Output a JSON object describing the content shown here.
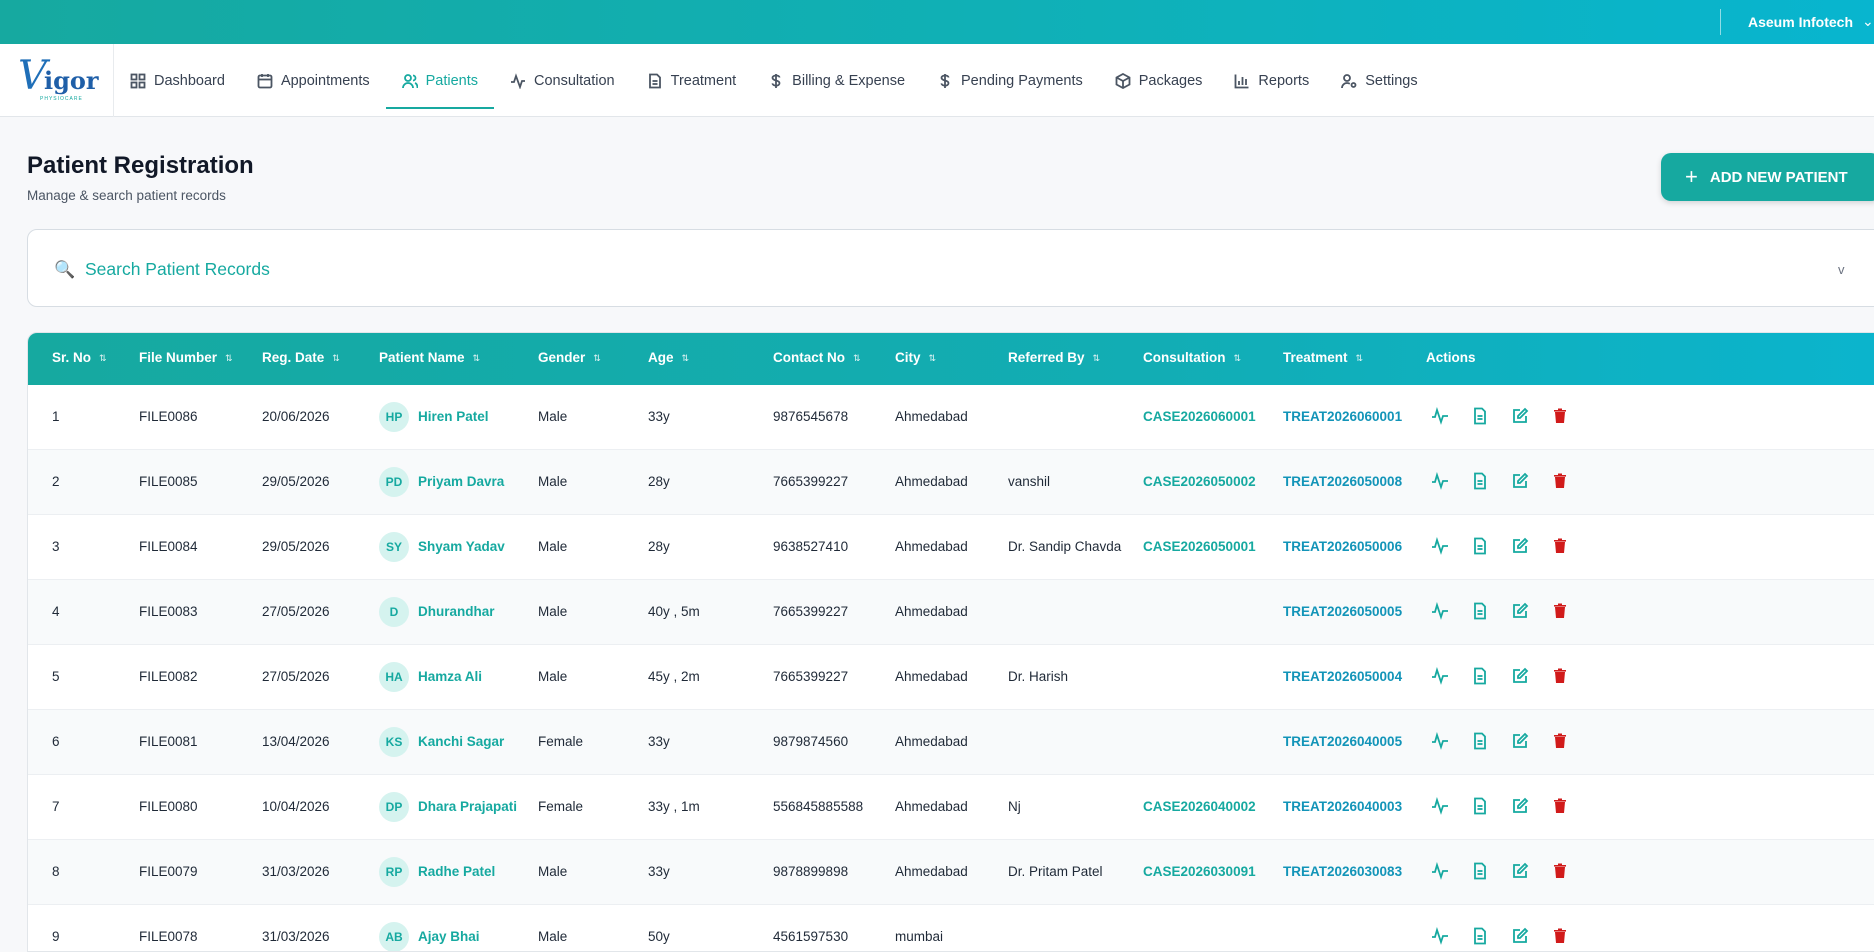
{
  "header": {
    "org": "Aseum Infotech"
  },
  "logo": {
    "letter": "V",
    "text": "igor",
    "tagline": "PHYSIOCARE"
  },
  "nav": [
    {
      "label": "Dashboard",
      "icon": "dashboard-icon"
    },
    {
      "label": "Appointments",
      "icon": "calendar-icon"
    },
    {
      "label": "Patients",
      "icon": "users-icon",
      "active": true
    },
    {
      "label": "Consultation",
      "icon": "activity-icon"
    },
    {
      "label": "Treatment",
      "icon": "document-icon"
    },
    {
      "label": "Billing & Expense",
      "icon": "dollar-icon"
    },
    {
      "label": "Pending Payments",
      "icon": "dollar-icon"
    },
    {
      "label": "Packages",
      "icon": "package-icon"
    },
    {
      "label": "Reports",
      "icon": "bar-chart-icon"
    },
    {
      "label": "Settings",
      "icon": "user-settings-icon"
    }
  ],
  "page": {
    "title": "Patient Registration",
    "subtitle": "Manage & search patient records",
    "add_button": "ADD NEW PATIENT"
  },
  "search": {
    "title": "Search Patient Records",
    "toggle": "v"
  },
  "table": {
    "columns": [
      "Sr. No",
      "File Number",
      "Reg. Date",
      "Patient Name",
      "Gender",
      "Age",
      "Contact No",
      "City",
      "Referred By",
      "Consultation",
      "Treatment",
      "Actions"
    ],
    "rows": [
      {
        "sr": "1",
        "file": "FILE0086",
        "date": "20/06/2026",
        "initials": "HP",
        "name": "Hiren Patel",
        "gender": "Male",
        "age": "33y",
        "contact": "9876545678",
        "city": "Ahmedabad",
        "ref": "",
        "consult": "CASE2026060001",
        "treat": "TREAT2026060001"
      },
      {
        "sr": "2",
        "file": "FILE0085",
        "date": "29/05/2026",
        "initials": "PD",
        "name": "Priyam Davra",
        "gender": "Male",
        "age": "28y",
        "contact": "7665399227",
        "city": "Ahmedabad",
        "ref": "vanshil",
        "consult": "CASE2026050002",
        "treat": "TREAT2026050008"
      },
      {
        "sr": "3",
        "file": "FILE0084",
        "date": "29/05/2026",
        "initials": "SY",
        "name": "Shyam Yadav",
        "gender": "Male",
        "age": "28y",
        "contact": "9638527410",
        "city": "Ahmedabad",
        "ref": "Dr. Sandip Chavda",
        "consult": "CASE2026050001",
        "treat": "TREAT2026050006"
      },
      {
        "sr": "4",
        "file": "FILE0083",
        "date": "27/05/2026",
        "initials": "D",
        "name": "Dhurandhar",
        "gender": "Male",
        "age": "40y , 5m",
        "contact": "7665399227",
        "city": "Ahmedabad",
        "ref": "",
        "consult": "",
        "treat": "TREAT2026050005"
      },
      {
        "sr": "5",
        "file": "FILE0082",
        "date": "27/05/2026",
        "initials": "HA",
        "name": "Hamza Ali",
        "gender": "Male",
        "age": "45y , 2m",
        "contact": "7665399227",
        "city": "Ahmedabad",
        "ref": "Dr. Harish",
        "consult": "",
        "treat": "TREAT2026050004"
      },
      {
        "sr": "6",
        "file": "FILE0081",
        "date": "13/04/2026",
        "initials": "KS",
        "name": "Kanchi Sagar",
        "gender": "Female",
        "age": "33y",
        "contact": "9879874560",
        "city": "Ahmedabad",
        "ref": "",
        "consult": "",
        "treat": "TREAT2026040005"
      },
      {
        "sr": "7",
        "file": "FILE0080",
        "date": "10/04/2026",
        "initials": "DP",
        "name": "Dhara Prajapati",
        "gender": "Female",
        "age": "33y , 1m",
        "contact": "556845885588",
        "city": "Ahmedabad",
        "ref": "Nj",
        "consult": "CASE2026040002",
        "treat": "TREAT2026040003"
      },
      {
        "sr": "8",
        "file": "FILE0079",
        "date": "31/03/2026",
        "initials": "RP",
        "name": "Radhe Patel",
        "gender": "Male",
        "age": "33y",
        "contact": "9878899898",
        "city": "Ahmedabad",
        "ref": "Dr. Pritam Patel",
        "consult": "CASE2026030091",
        "treat": "TREAT2026030083"
      },
      {
        "sr": "9",
        "file": "FILE0078",
        "date": "31/03/2026",
        "initials": "AB",
        "name": "Ajay Bhai",
        "gender": "Male",
        "age": "50y",
        "contact": "4561597530",
        "city": "mumbai",
        "ref": "",
        "consult": "",
        "treat": ""
      }
    ]
  },
  "colors": {
    "primary": "#16a9a0",
    "link_blue": "#1294b8",
    "delete": "#d11a1a"
  }
}
